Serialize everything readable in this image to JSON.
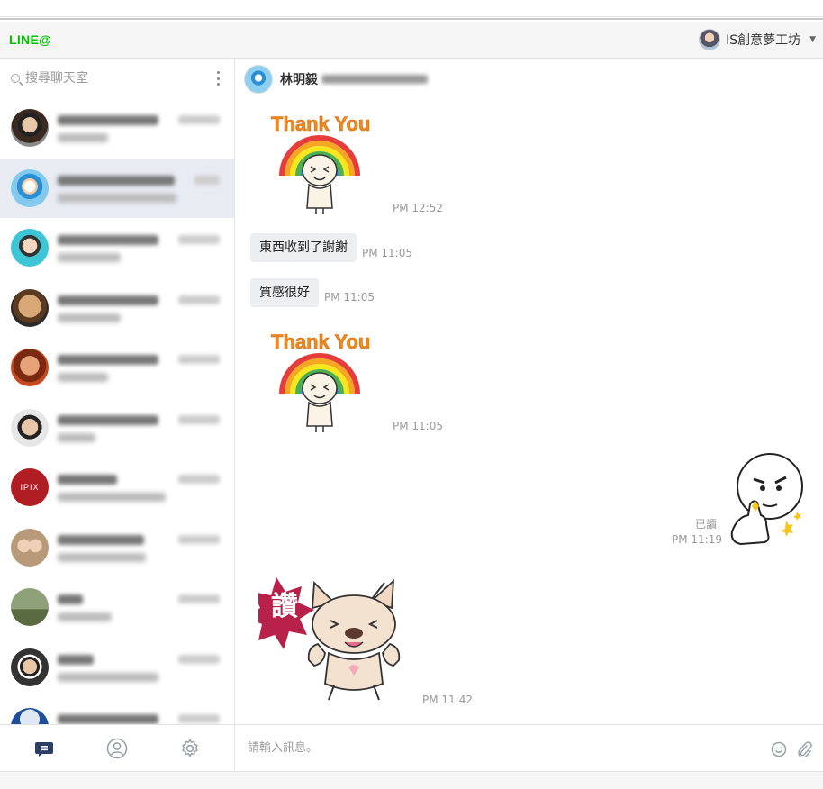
{
  "app": {
    "logo": "LINE@"
  },
  "account": {
    "name": "IS創意夢工坊"
  },
  "search": {
    "placeholder": "搜尋聊天室"
  },
  "conversation": {
    "name": "林明毅",
    "messages": [
      {
        "type": "sticker",
        "sticker": "thank-you-rainbow-sticker",
        "sticker_text": "Thank You!",
        "time": "PM 12:52",
        "side": "left"
      },
      {
        "type": "text",
        "text": "東西收到了謝謝",
        "time": "PM 11:05",
        "side": "left"
      },
      {
        "type": "text",
        "text": "質感很好",
        "time": "PM 11:05",
        "side": "left"
      },
      {
        "type": "sticker",
        "sticker": "thank-you-rainbow-sticker",
        "sticker_text": "Thank You!",
        "time": "PM 11:05",
        "side": "left"
      },
      {
        "type": "sticker",
        "sticker": "thumbs-up-face-sticker",
        "read": "已讀",
        "time": "PM 11:19",
        "side": "right"
      },
      {
        "type": "sticker",
        "sticker": "bulldog-praise-sticker",
        "sticker_text": "讚",
        "time": "PM 11:42",
        "side": "left"
      }
    ]
  },
  "input": {
    "placeholder": "請輸入訊息。"
  },
  "chat_list": [
    {
      "avatar": "avatar-woman-sunglasses",
      "active": false
    },
    {
      "avatar": "avatar-cartoon-boy",
      "active": true
    },
    {
      "avatar": "avatar-woman-cyan",
      "active": false
    },
    {
      "avatar": "avatar-woman-closeup",
      "active": false
    },
    {
      "avatar": "avatar-woman-red",
      "active": false
    },
    {
      "avatar": "avatar-man-glasses",
      "active": false
    },
    {
      "avatar": "avatar-ipix-logo",
      "active": false,
      "logo_text": "IPIX"
    },
    {
      "avatar": "avatar-two-women",
      "active": false
    },
    {
      "avatar": "avatar-outdoor",
      "active": false
    },
    {
      "avatar": "avatar-man-rays",
      "active": false
    },
    {
      "avatar": "avatar-blue-sky",
      "active": false
    }
  ],
  "colors": {
    "brand": "#00c300",
    "active_row": "#e8ebf2",
    "bubble": "#edeef0",
    "nav_active": "#2c3e66"
  },
  "icons": {
    "chat_nav": "chat-bubble-icon",
    "friends_nav": "person-icon",
    "settings_nav": "gear-icon",
    "emoji": "smiley-icon",
    "attach": "paperclip-icon"
  }
}
